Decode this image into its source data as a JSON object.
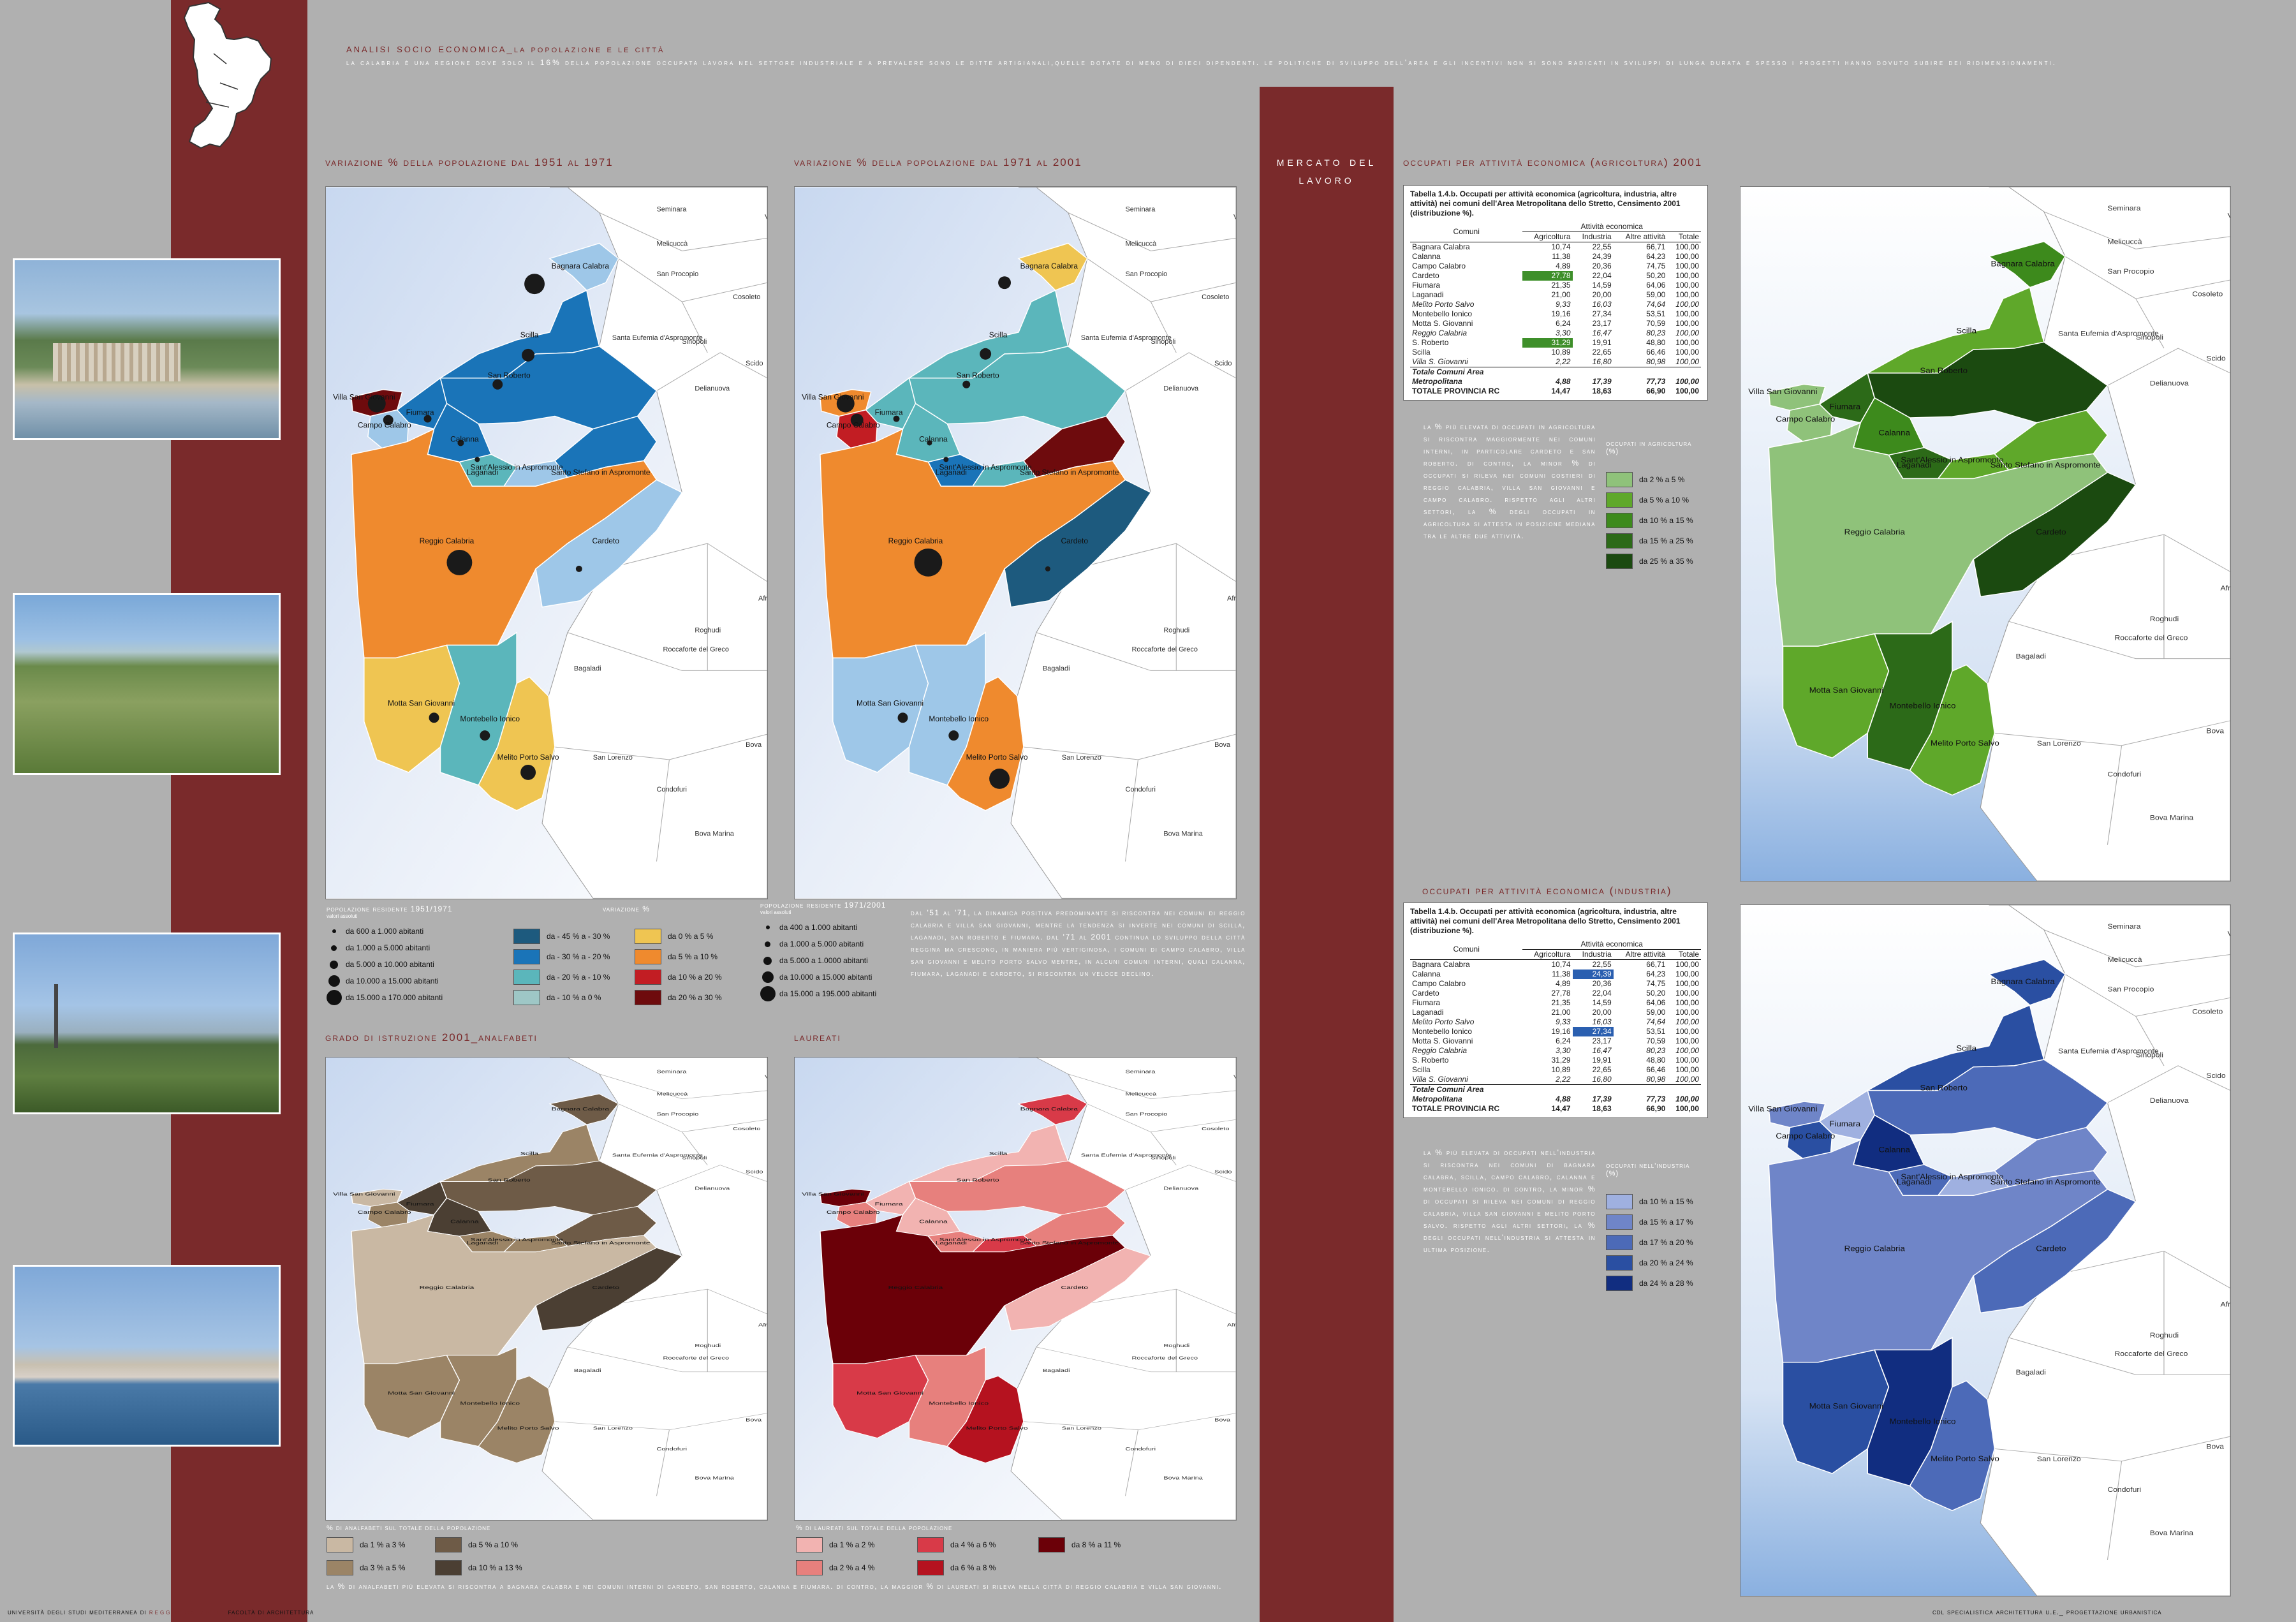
{
  "header": {
    "title_main": "analisi socio economica",
    "title_sub": "_la popolazione e le città",
    "intro": "la calabria è una regione dove solo il 16% della popolazione occupata lavora nel settore industriale e a prevalere sono le ditte artigianali,quelle dotate di meno di dieci dipendenti. le politiche di sviluppo dell'area e gli incentivi non si sono radicati in sviluppi di lunga durata e spesso i progetti hanno dovuto subire dei ridimensionamenti."
  },
  "sections": {
    "var1951": "variazione % della popolazione dal 1951 al 1971",
    "var1971": "variazione % della popolazione dal 1971 al 2001",
    "istruzione": "grado di istruzione 2001_analfabeti",
    "laureati": "laureati",
    "mercato": "mercato del lavoro",
    "agricoltura": "occupati per attività economica (agricoltura) 2001",
    "industria": "occupati per attività economica (industria)"
  },
  "legend_pop1951": {
    "title": "popolazione residente 1951/1971",
    "subtitle": "valori assoluti",
    "items": [
      "da 600 a 1.000 abitanti",
      "da 1.000 a 5.000 abitanti",
      "da 5.000 a 10.000 abitanti",
      "da 10.000 a 15.000 abitanti",
      "da 15.000 a 170.000 abitanti"
    ]
  },
  "legend_variazione": {
    "title": "variazione %",
    "neg": [
      "da - 45 % a - 30 %",
      "da - 30 % a - 20 %",
      "da - 20 % a - 10 %",
      "da - 10 % a 0 %"
    ],
    "pos": [
      "da 0 % a 5 %",
      "da 5 % a 10 %",
      "da 10 % a 20 %",
      "da 20 % a 30 %"
    ],
    "neg_colors": [
      "#1d5a7e",
      "#1a74b8",
      "#5bb6bb",
      "#9ec7c6"
    ],
    "pos_colors": [
      "#efc552",
      "#ef8a2e",
      "#c21d23",
      "#6e0b0d"
    ]
  },
  "legend_pop2001": {
    "title": "popolazione residente 1971/2001",
    "subtitle": "valori assoluti",
    "items": [
      "da 400 a 1.000 abitanti",
      "da 1.000 a 5.000 abitanti",
      "da 5.000 a 1.0000 abitanti",
      "da 10.000 a 15.000 abitanti",
      "da 15.000 a 195.000 abitanti"
    ]
  },
  "text_1951_2001": "dal '51 al '71, la dinamica positiva predominante si riscontra nei comuni di reggio calabria e villa san giovanni, mentre la tendenza si inverte nei comuni di scilla, laganadi, san roberto e fiumara. dal '71 al 2001 continua lo sviluppo della città reggina ma crescono, in maniera più vertiginosa, i comuni di campo calabro, villa san giovanni e melito porto salvo mentre, in alcuni comuni interni, quali calanna, fiumara, laganadi e cardeto, si riscontra un veloce declino.",
  "legend_analfabeti": {
    "title": "% di analfabeti sul totale della popolazione",
    "items": [
      "da 1 % a 3 %",
      "da 3 % a 5 %",
      "da 5 % a 10 %",
      "da 10 % a 13 %"
    ],
    "colors": [
      "#c9b8a3",
      "#9b8466",
      "#6e5b47",
      "#4b3f33"
    ]
  },
  "legend_laureati": {
    "title": "% di laureati sul totale della popolazione",
    "items": [
      "da 1 % a 2 %",
      "da 2 % a 4 %",
      "da 4 % a 6 %",
      "da 6 % a 8 %",
      "da 8 % a 11 %"
    ],
    "colors": [
      "#f2b3b1",
      "#e7807d",
      "#d83a48",
      "#b5121f",
      "#6b0008"
    ]
  },
  "text_istruzione": "la % di analfabeti più elevata si riscontra a bagnara calabra e nei comuni interni di cardeto, san roberto, calanna e fiumara. di contro, la maggior % di laureati si rileva nella città di reggio calabria e villa san giovanni.",
  "table_agri": {
    "caption": "Tabella 1.4.b. Occupati per attività economica (agricoltura, industria, altre attività) nei comuni dell'Area Metropolitana dello Stretto, Censimento 2001 (distribuzione %).",
    "group_header": "Attività economica",
    "columns": [
      "Comuni",
      "Agricoltura",
      "Industria",
      "Altre attività",
      "Totale"
    ],
    "rows": [
      [
        "Bagnara Calabra",
        "10,74",
        "22,55",
        "66,71",
        "100,00"
      ],
      [
        "Calanna",
        "11,38",
        "24,39",
        "64,23",
        "100,00"
      ],
      [
        "Campo Calabro",
        "4,89",
        "20,36",
        "74,75",
        "100,00"
      ],
      [
        "Cardeto",
        "27,78",
        "22,04",
        "50,20",
        "100,00"
      ],
      [
        "Fiumara",
        "21,35",
        "14,59",
        "64,06",
        "100,00"
      ],
      [
        "Laganadi",
        "21,00",
        "20,00",
        "59,00",
        "100,00"
      ],
      [
        "Melito Porto Salvo",
        "9,33",
        "16,03",
        "74,64",
        "100,00"
      ],
      [
        "Montebello Ionico",
        "19,16",
        "27,34",
        "53,51",
        "100,00"
      ],
      [
        "Motta S. Giovanni",
        "6,24",
        "23,17",
        "70,59",
        "100,00"
      ],
      [
        "Reggio Calabria",
        "3,30",
        "16,47",
        "80,23",
        "100,00"
      ],
      [
        "S. Roberto",
        "31,29",
        "19,91",
        "48,80",
        "100,00"
      ],
      [
        "Scilla",
        "10,89",
        "22,65",
        "66,46",
        "100,00"
      ],
      [
        "Villa S. Giovanni",
        "2,22",
        "16,80",
        "80,98",
        "100,00"
      ]
    ],
    "total_label": "Totale Comuni Area",
    "metro_row": [
      "Metropolitana",
      "4,88",
      "17,39",
      "77,73",
      "100,00"
    ],
    "prov_row": [
      "TOTALE PROVINCIA RC",
      "14,47",
      "18,63",
      "66,90",
      "100,00"
    ]
  },
  "text_agri": "la % più elevata di occupati in agricoltura si riscontra maggiormente nei comuni interni, in particolare cardeto e san roberto. di contro, la minor % di occupati si rileva nei comuni costieri di reggio calabria, villa san giovanni e campo calabro. rispetto agli altri settori, la % degli occupati in agricoltura si attesta in posizione mediana tra le altre due attività.",
  "legend_agri": {
    "title": "occupati in agricoltura (%)",
    "items": [
      "da 2 % a 5 %",
      "da 5 % a 10 %",
      "da 10 % a 15 %",
      "da 15 % a 25 %",
      "da 25 % a 35 %"
    ],
    "colors": [
      "#8fc27a",
      "#5fa82a",
      "#3d8a1c",
      "#2c6a18",
      "#1b4a10"
    ]
  },
  "text_ind": "la % più elevata di occupati nell'industria si riscontra nei comuni di bagnara calabra, scilla, campo calabro, calanna e montebello ionico. di contro, la minor % di occupati si rileva nei comuni di reggio calabria, villa san giovanni e melito porto salvo. rispetto agli altri settori, la % degli occupati nell'industria si attesta in ultima posizione.",
  "legend_ind": {
    "title": "occupati nell'industria (%)",
    "items": [
      "da 10 % a 15 %",
      "da 15 % a 17 %",
      "da 17 % a 20 %",
      "da 20 % a 24 %",
      "da 24 % a 28 %"
    ],
    "colors": [
      "#9fb0e0",
      "#6f85c8",
      "#4c6ab8",
      "#2a4fa2",
      "#112d80"
    ]
  },
  "place_names": {
    "seminara": "Seminara",
    "varapodio": "Varapodio",
    "melicucca": "Melicuccà",
    "bagnara": "Bagnara Calabra",
    "scilla": "Scilla",
    "santa_eufemia": "Santa Eufemia d'Aspromonte",
    "sinopoli": "Sinopoli",
    "san_procopio": "San Procopio",
    "cosoleto": "Cosoleto",
    "delianuova": "Delianuova",
    "scido": "Scido",
    "villa": "Villa San Giovanni",
    "campo": "Campo Calabro",
    "fiumara": "Fiumara",
    "san_roberto": "San Roberto",
    "calanna": "Calanna",
    "laganadi": "Laganadi",
    "sant_alessio": "Sant'Alessio in Aspromonte",
    "santo_stefano": "Santo Stefano in Aspromonte",
    "reggio": "Reggio Calabria",
    "cardeto": "Cardeto",
    "africo": "Africo",
    "roghudi": "Roghudi",
    "roccaforte": "Roccaforte del Greco",
    "bagaladi": "Bagaladi",
    "bova": "Bova",
    "san_lorenzo": "San Lorenzo",
    "condofuri": "Condofuri",
    "motta": "Motta San Giovanni",
    "montebello": "Montebello Ionico",
    "melito": "Melito Porto Salvo",
    "bova_marina": "Bova Marina"
  },
  "footer": {
    "left1": "università degli studi mediterranea di",
    "left2": "reggio calabria",
    "left3": "facoltà di architettura",
    "right": "cdl specialistica architettura u.e._ progettazione urbanistica"
  }
}
